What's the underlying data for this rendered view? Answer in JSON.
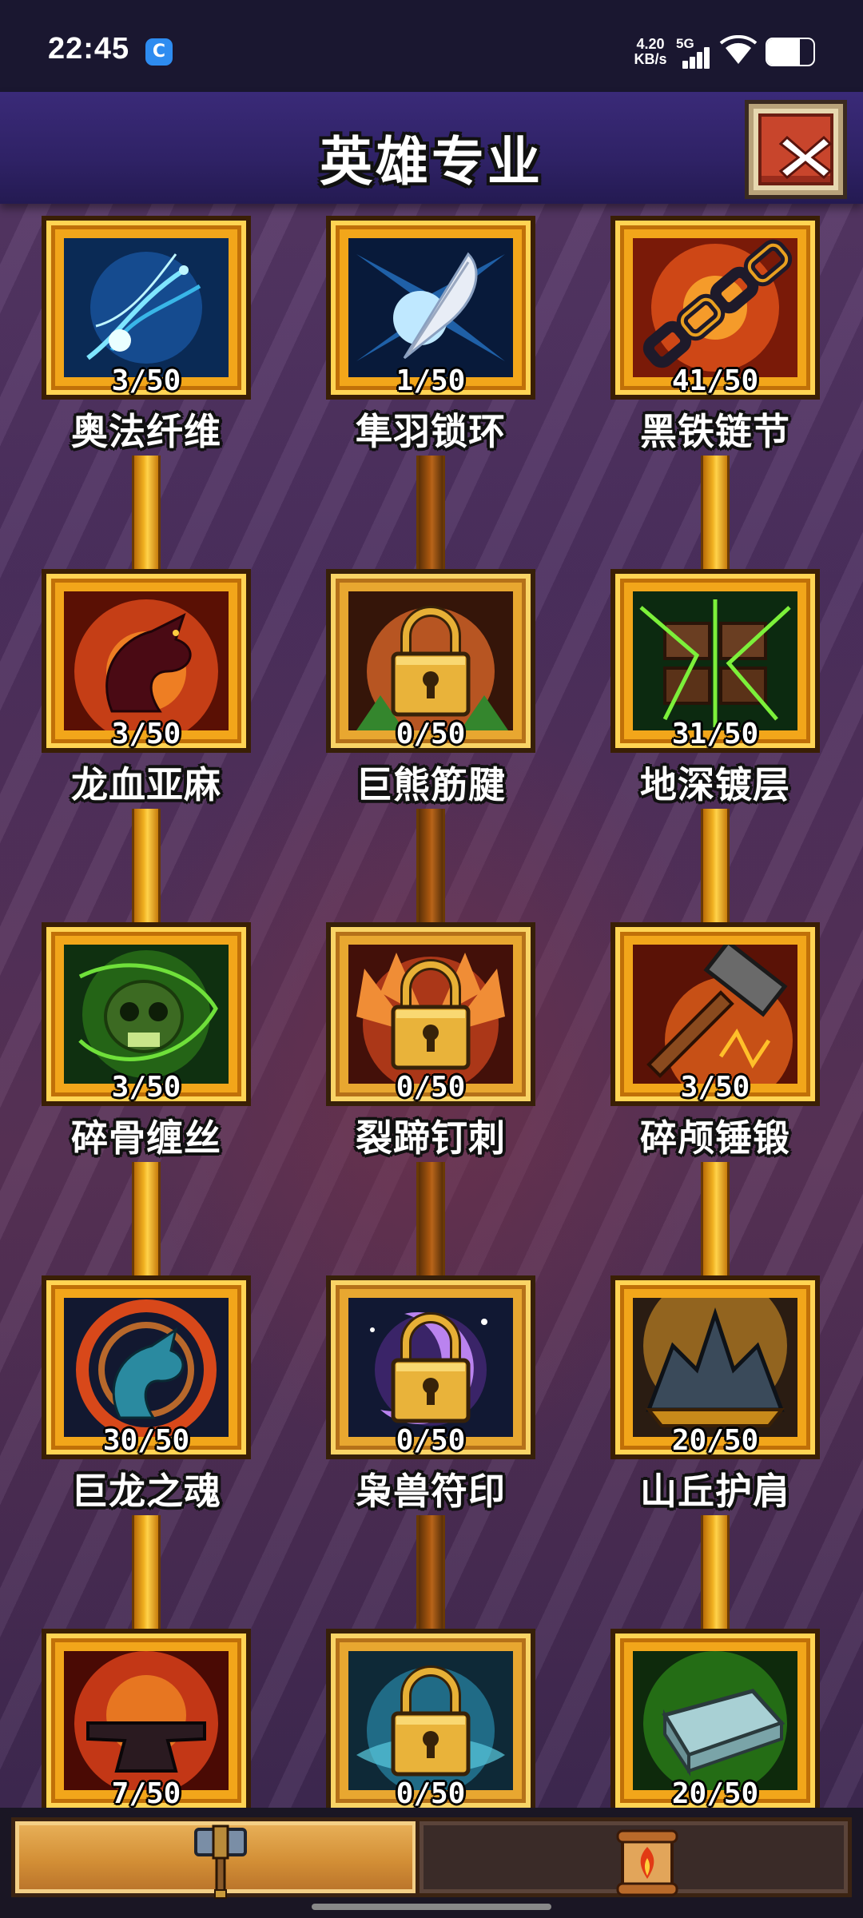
{
  "status_bar": {
    "time": "22:45",
    "net_speed_value": "4.20",
    "net_speed_unit": "KB/s",
    "network": "5G",
    "battery_level": 0.7
  },
  "header": {
    "title": "英雄专业",
    "close_icon": "close-x-icon"
  },
  "specializations": [
    {
      "name": "奥法纤维",
      "count": "3/50",
      "locked": false,
      "icon": "arcane-fiber-icon"
    },
    {
      "name": "隼羽锁环",
      "count": "1/50",
      "locked": false,
      "icon": "feather-icon"
    },
    {
      "name": "黑铁链节",
      "count": "41/50",
      "locked": false,
      "icon": "chain-icon"
    },
    {
      "name": "龙血亚麻",
      "count": "3/50",
      "locked": false,
      "icon": "dragon-flame-icon"
    },
    {
      "name": "巨熊筋腱",
      "count": "0/50",
      "locked": true,
      "icon": "lock-icon"
    },
    {
      "name": "地深镀层",
      "count": "31/50",
      "locked": false,
      "icon": "earth-plates-icon"
    },
    {
      "name": "碎骨缠丝",
      "count": "3/50",
      "locked": false,
      "icon": "skull-vine-icon"
    },
    {
      "name": "裂蹄钉刺",
      "count": "0/50",
      "locked": true,
      "icon": "lock-icon"
    },
    {
      "name": "碎颅锤锻",
      "count": "3/50",
      "locked": false,
      "icon": "hammer-icon"
    },
    {
      "name": "巨龙之魂",
      "count": "30/50",
      "locked": false,
      "icon": "dragon-soul-icon"
    },
    {
      "name": "枭兽符印",
      "count": "0/50",
      "locked": true,
      "icon": "lock-icon"
    },
    {
      "name": "山丘护肩",
      "count": "20/50",
      "locked": false,
      "icon": "pauldron-icon"
    },
    {
      "name": "",
      "count": "7/50",
      "locked": false,
      "icon": "anvil-icon"
    },
    {
      "name": "",
      "count": "0/50",
      "locked": true,
      "icon": "lock-icon"
    },
    {
      "name": "",
      "count": "20/50",
      "locked": false,
      "icon": "ingot-icon"
    }
  ],
  "tabs": [
    {
      "id": "forge",
      "icon": "hammer-tab-icon",
      "active": true
    },
    {
      "id": "scroll",
      "icon": "scroll-tab-icon",
      "active": false
    }
  ],
  "colors": {
    "frame_gold": "#f2a61a",
    "header_purple": "#2f2266",
    "close_red": "#c8452c"
  }
}
